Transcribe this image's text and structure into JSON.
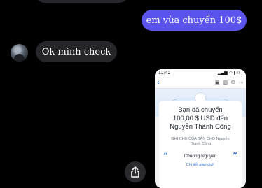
{
  "messages": {
    "sent_text": "em vừa chuyển 100$",
    "received_text": "Ok mình check"
  },
  "receipt_image": {
    "status_time": "12:42",
    "battery": "27",
    "title_line1": "Bạn đã chuyển",
    "title_line2": "100,00 $ USD đến",
    "title_line3": "Nguyễn Thành Công",
    "note_line1": "GHI CHÚ CỦA BẠN CHO Nguyễn",
    "note_line2": "Thành Công",
    "open_quote": "“",
    "close_quote": "”",
    "sender_name": "Chuong Nguyen",
    "detail_link": "Chi tiết giao dịch"
  },
  "colors": {
    "background": "#000000",
    "sent_bubble": "#5b54ec",
    "received_bubble": "#26252a",
    "link_blue": "#2f6fd8"
  },
  "icons": {
    "share": "share-icon",
    "back": "back-chevron-icon"
  }
}
